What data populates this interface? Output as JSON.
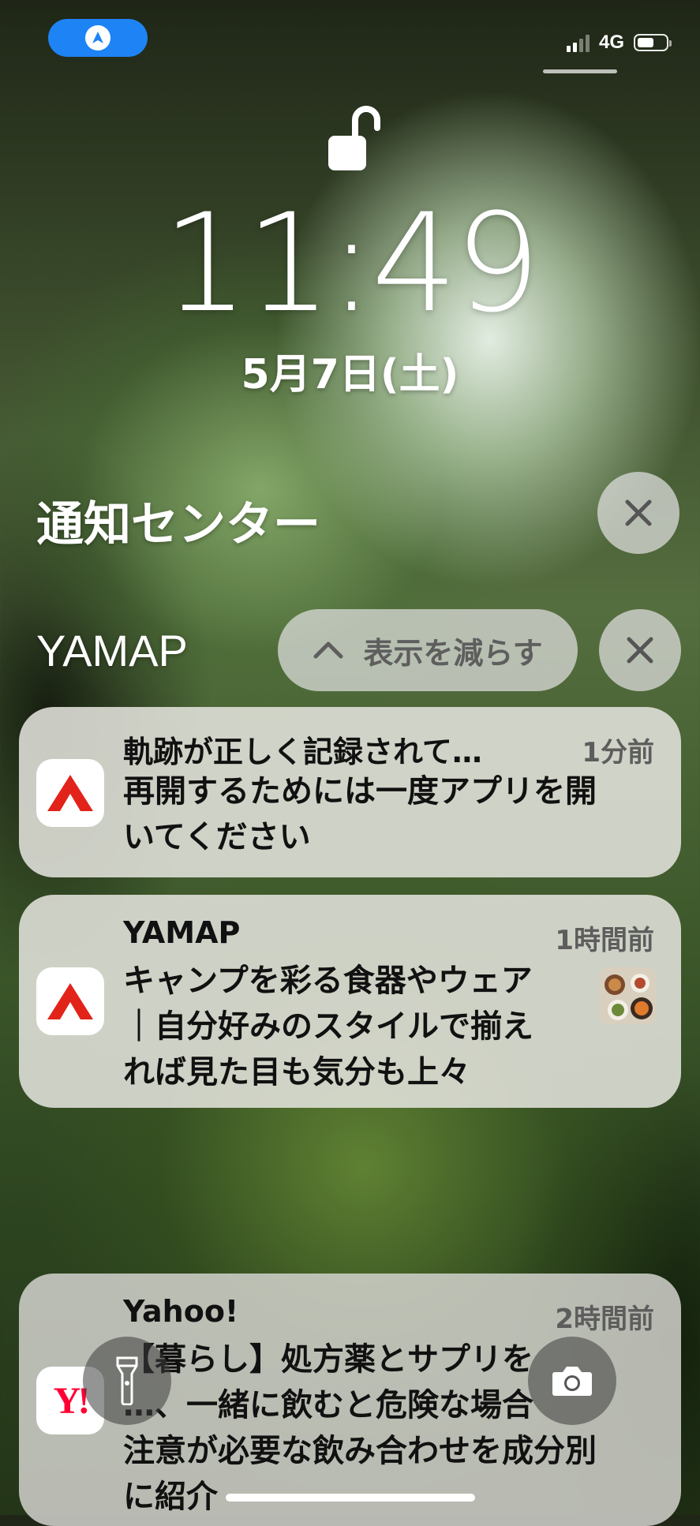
{
  "status_bar": {
    "network": "4G",
    "battery_level_percent": 62,
    "nav_icon": "navigation-arrow-icon",
    "nav_color": "#1e84f5"
  },
  "lock_screen": {
    "time": "11:49",
    "date": "5月7日(土)",
    "lock_icon": "unlocked-padlock-icon"
  },
  "notification_center": {
    "title": "通知センター",
    "clear_icon": "close-icon"
  },
  "group": {
    "app_name": "YAMAP",
    "show_less_label": "表示を減らす",
    "show_less_icon": "chevron-up-icon",
    "clear_icon": "close-icon"
  },
  "notifications": [
    {
      "app": "YAMAP",
      "icon": "yamap-logo-icon",
      "title": "軌跡が正しく記録されて…",
      "time": "1分前",
      "body": [
        "再開するためには一度アプリを開",
        "いてください"
      ]
    },
    {
      "app": "YAMAP",
      "icon": "yamap-logo-icon",
      "title": "YAMAP",
      "time": "1時間前",
      "body": [
        "キャンプを彩る食器やウェア",
        "｜自分好みのスタイルで揃え",
        "れば見た目も気分も上々"
      ],
      "thumbnail": "food-thumbnail-icon"
    },
    {
      "app": "Yahoo!",
      "icon": "yahoo-logo-icon",
      "title": "Yahoo!",
      "time": "2時間前",
      "body": [
        "【暮らし】処方薬とサプリを",
        "…、一緒に飲むと危険な場合",
        "注意が必要な飲み合わせを成分別",
        "に紹介"
      ]
    }
  ],
  "controls": {
    "flashlight_icon": "flashlight-icon",
    "camera_icon": "camera-icon"
  },
  "colors": {
    "yamap_red": "#e2231a",
    "yahoo_red": "#ff0033",
    "card_bg": "#e2e2dc"
  }
}
